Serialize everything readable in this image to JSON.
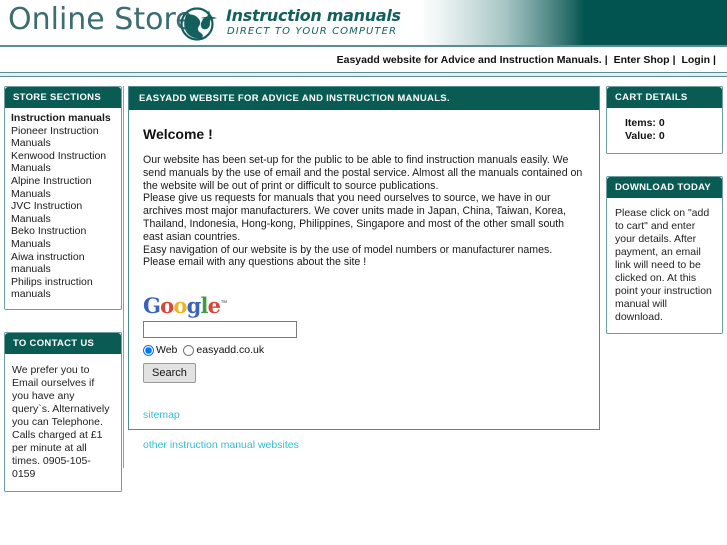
{
  "header": {
    "store_name": "Online Store",
    "brand_title": "Instruction manuals",
    "brand_subtitle": "DIRECT TO YOUR COMPUTER",
    "globe_icon": "globe-icon"
  },
  "topnav": {
    "tagline": "Easyadd website for Advice and Instruction Manuals.",
    "enter_shop": "Enter Shop",
    "login": "Login",
    "separator": "|"
  },
  "sidebar_left": {
    "store_sections": {
      "title": "STORE SECTIONS",
      "items": [
        {
          "label": "Instruction manuals",
          "current": true
        },
        {
          "label": "Pioneer Instruction Manuals",
          "current": false
        },
        {
          "label": "Kenwood Instruction Manuals",
          "current": false
        },
        {
          "label": "Alpine Instruction Manuals",
          "current": false
        },
        {
          "label": "JVC Instruction Manuals",
          "current": false
        },
        {
          "label": "Beko Instruction Manuals",
          "current": false
        },
        {
          "label": "Aiwa instruction manuals",
          "current": false
        },
        {
          "label": "Philips instruction manuals",
          "current": false
        }
      ]
    },
    "contact": {
      "title": "TO CONTACT US",
      "text": "We prefer you to Email ourselves if you have any query`s. Alternatively you can Telephone. Calls charged at £1 per minute at all times. 0905-105-0159"
    }
  },
  "main": {
    "title": "EASYADD WEBSITE FOR ADVICE AND INSTRUCTION MANUALS.",
    "welcome": "Welcome !",
    "paragraphs": [
      "Our website has been set-up for the public to be able to find instruction manuals easily. We send manuals by the use of email and the postal service. Almost all the manuals contained on the website will be out of print or difficult to source publications.",
      "Please give us requests for manuals that you need ourselves to source, we have in our archives most major manufacturers. We cover units made in Japan, China, Taiwan, Korea, Thailand, Indonesia, Hong-kong, Philippines, Singapore and most of the other small south east asian countries.",
      "Easy navigation of our website is by the use of model numbers or manufacturer names.",
      "Please email with any questions about the site !"
    ],
    "google": {
      "logo_letters": [
        {
          "char": "G",
          "color": "#3a63bb"
        },
        {
          "char": "o",
          "color": "#d9453a"
        },
        {
          "char": "o",
          "color": "#efb220"
        },
        {
          "char": "g",
          "color": "#3a63bb"
        },
        {
          "char": "l",
          "color": "#3f9c41"
        },
        {
          "char": "e",
          "color": "#d9453a"
        }
      ],
      "trademark": "™",
      "query_value": "",
      "query_placeholder": "",
      "radio_web": "Web",
      "radio_site": "easyadd.co.uk",
      "selected_scope": "Web",
      "search_button": "Search"
    },
    "links": [
      {
        "label": "sitemap"
      },
      {
        "label": "other instruction manual websites"
      }
    ]
  },
  "sidebar_right": {
    "cart": {
      "title": "CART DETAILS",
      "items_label": "Items: 0",
      "value_label": "Value: 0"
    },
    "download": {
      "title": "DOWNLOAD TODAY",
      "text": "Please click on \"add to cart\" and enter your details. After payment, an email link will need to be clicked on. At this point your instruction manual will download."
    }
  },
  "colors": {
    "teal_dark": "#0b5b55",
    "teal_border": "#6d9ea1",
    "link_cyan": "#37bcd4",
    "logo_teal": "#3b6e70"
  }
}
